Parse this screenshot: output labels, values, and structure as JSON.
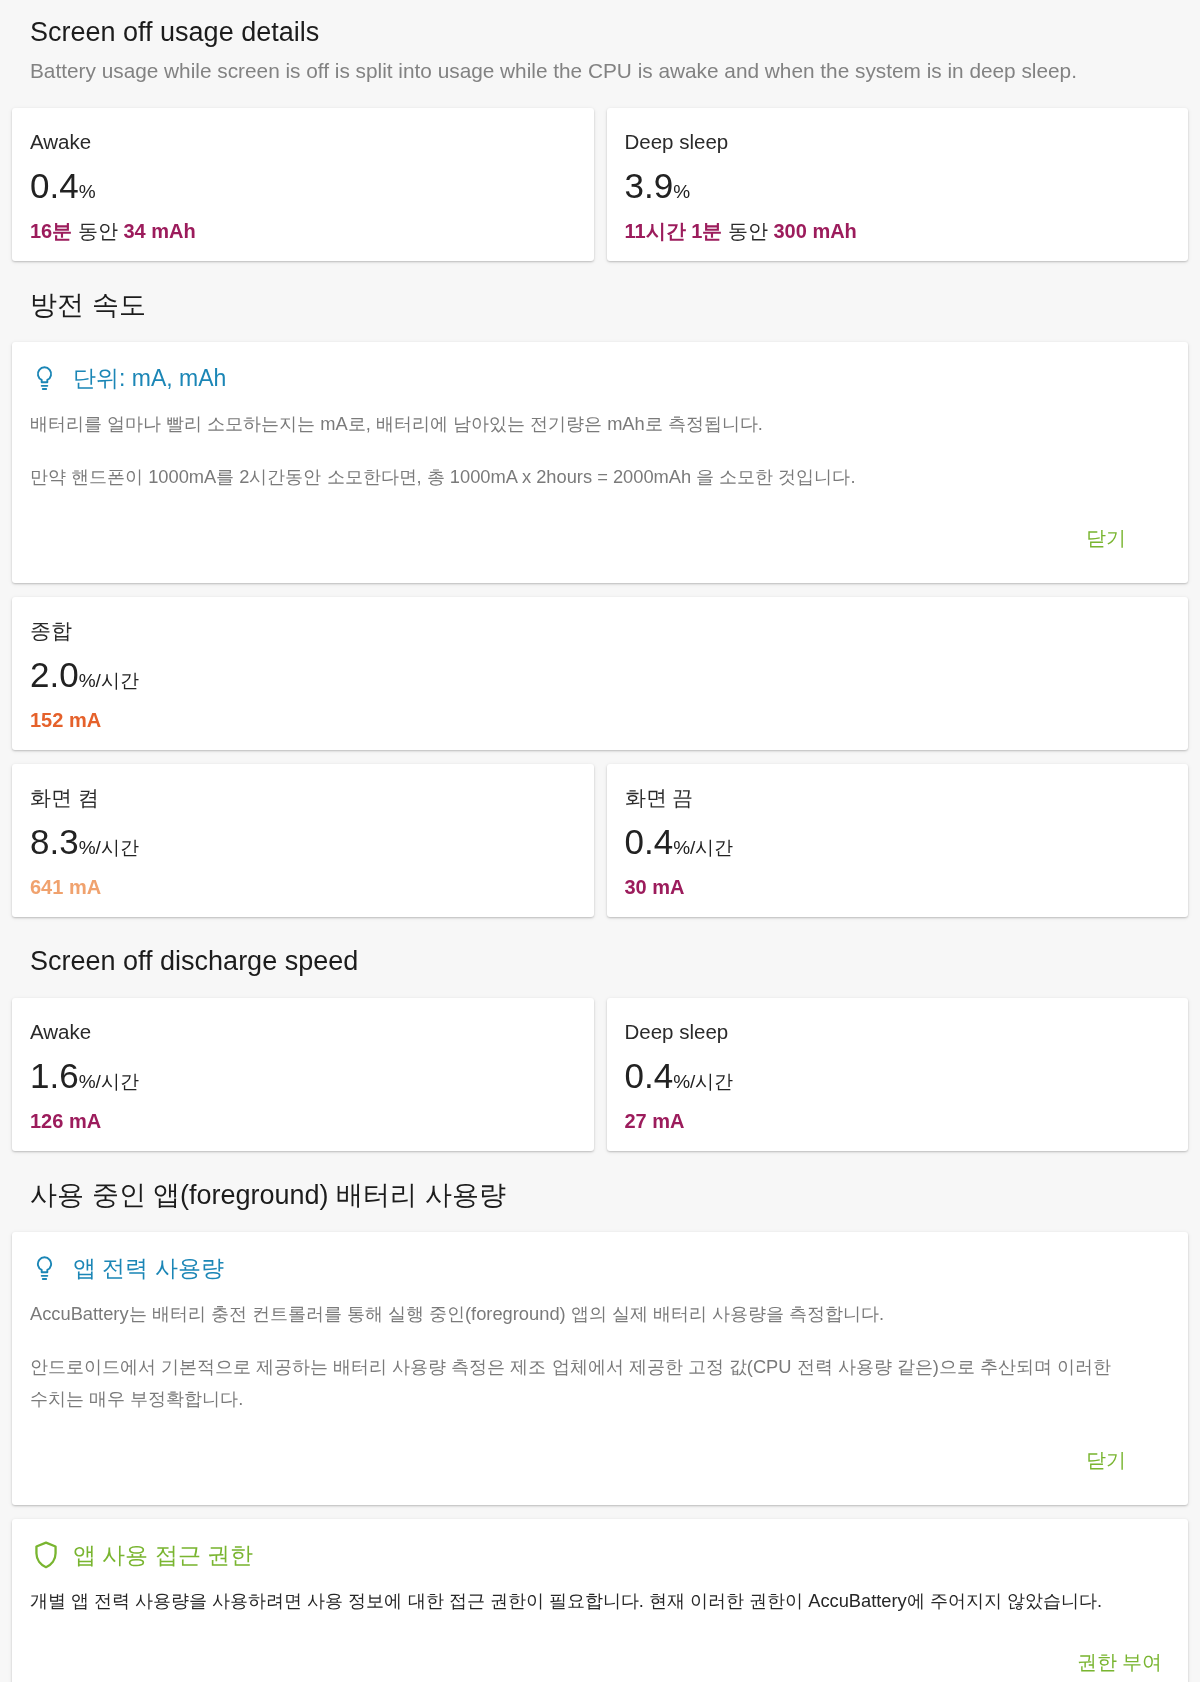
{
  "sections": [
    {
      "title": "Screen off usage details",
      "subtitle": "Battery usage while screen is off is split into usage while the CPU is awake and when the system is in deep sleep.",
      "blocks": [
        {
          "kind": "stat_row",
          "cards": [
            {
              "kind": "usage",
              "label": "Awake",
              "value": "0.4",
              "unit": "%",
              "detail": "**16분** 동안 **34 mAh**",
              "color": "#9c1c5c"
            },
            {
              "kind": "usage",
              "label": "Deep sleep",
              "value": "3.9",
              "unit": "%",
              "detail": "**11시간 1분** 동안 **300 mAh**",
              "color": "#9c1c5c"
            }
          ]
        }
      ]
    },
    {
      "title": "방전 속도",
      "blocks": [
        {
          "kind": "tip",
          "title": "단위: mA, mAh",
          "paragraphs": [
            "배터리를 얼마나 빨리 소모하는지는 mA로, 배터리에 남아있는 전기량은 mAh로 측정됩니다.",
            "만약 핸드폰이 1000mA를 2시간동안 소모한다면, 총 1000mA x 2hours = 2000mAh 을 소모한 것입니다."
          ],
          "action": "닫기"
        },
        {
          "kind": "stat_row",
          "cards": [
            {
              "kind": "rate",
              "label": "종합",
              "value": "2.0",
              "unit": "%/시간",
              "detail": "152 mA",
              "color": "#e5612b"
            }
          ]
        },
        {
          "kind": "stat_row",
          "cards": [
            {
              "kind": "rate",
              "label": "화면 켬",
              "value": "8.3",
              "unit": "%/시간",
              "detail": "641 mA",
              "color": "#f0a26e"
            },
            {
              "kind": "rate",
              "label": "화면 끔",
              "value": "0.4",
              "unit": "%/시간",
              "detail": "30 mA",
              "color": "#9c1c5c"
            }
          ]
        }
      ]
    },
    {
      "title": "Screen off discharge speed",
      "blocks": [
        {
          "kind": "stat_row",
          "cards": [
            {
              "kind": "rate",
              "label": "Awake",
              "value": "1.6",
              "unit": "%/시간",
              "detail": "126 mA",
              "color": "#9c1c5c"
            },
            {
              "kind": "rate",
              "label": "Deep sleep",
              "value": "0.4",
              "unit": "%/시간",
              "detail": "27 mA",
              "color": "#9c1c5c"
            }
          ]
        }
      ]
    },
    {
      "title": "사용 중인 앱(foreground) 배터리 사용량",
      "blocks": [
        {
          "kind": "tip",
          "title": "앱 전력 사용량",
          "paragraphs": [
            "AccuBattery는 배터리 충전 컨트롤러를 통해 실행 중인(foreground) 앱의 실제 배터리 사용량을 측정합니다.",
            "안드로이드에서 기본적으로 제공하는 배터리 사용량 측정은 제조 업체에서 제공한 고정 값(CPU 전력 사용량 같은)으로 추산되며 이러한 수치는 매우 부정확합니다."
          ],
          "action": "닫기"
        },
        {
          "kind": "permission",
          "title": "앱 사용 접근 권한",
          "paragraphs": [
            "개별 앱 전력 사용량을 사용하려면 사용 정보에 대한 접근 권한이 필요합니다. 현재 이러한 권한이 AccuBattery에 주어지지 않았습니다."
          ],
          "action": "권한 부여"
        }
      ]
    }
  ]
}
